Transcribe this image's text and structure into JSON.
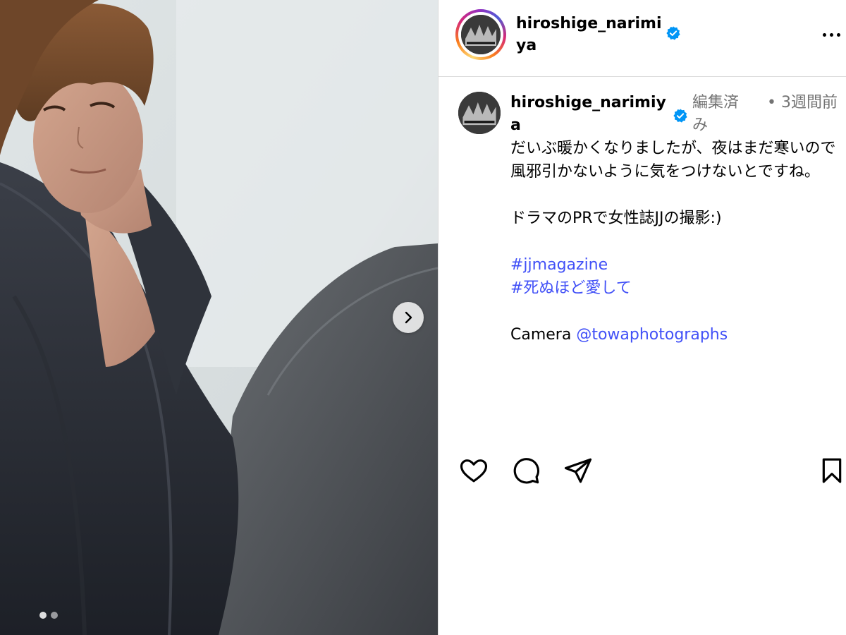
{
  "post": {
    "username": "hiroshige_narimiya",
    "verified": true,
    "more_icon": "more-horizontal-icon"
  },
  "caption": {
    "username": "hiroshige_narimiya",
    "edited_label": "編集済み",
    "separator": "•",
    "time_ago": "3週間前",
    "text_line_1": "だいぶ暖かくなりましたが、夜はまだ寒いので風邪引かないように気をつけないとですね。",
    "text_line_2": "ドラマのPRで女性誌JJの撮影:)",
    "hashtags": [
      "#jjmagazine",
      "#死ぬほど愛して"
    ],
    "credit_prefix": "Camera ",
    "credit_mention": "@towaphotographs"
  },
  "media": {
    "carousel_total": 2,
    "carousel_active": 1,
    "next_icon": "chevron-right-icon"
  },
  "actions": {
    "icons": [
      "heart-icon",
      "comment-icon",
      "share-icon",
      "bookmark-icon"
    ]
  },
  "colors": {
    "link": "#4150f7",
    "verified": "#0095f6",
    "muted": "#737373",
    "divider": "#dbdbdb"
  }
}
